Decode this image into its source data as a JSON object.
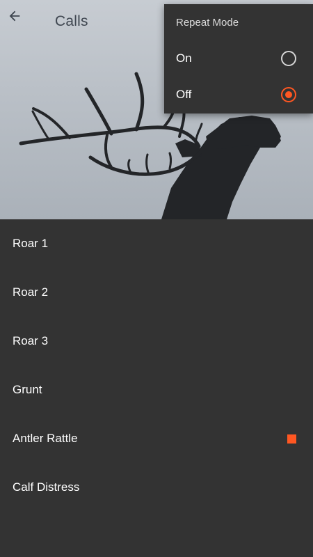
{
  "header": {
    "title": "Calls",
    "back_icon": "arrow-back-icon"
  },
  "hero": {
    "image": "elk-silhouette-photo"
  },
  "calls": [
    {
      "label": "Roar 1",
      "playing": false
    },
    {
      "label": "Roar 2",
      "playing": false
    },
    {
      "label": "Roar 3",
      "playing": false
    },
    {
      "label": "Grunt",
      "playing": false
    },
    {
      "label": "Antler Rattle",
      "playing": true
    },
    {
      "label": "Calf Distress",
      "playing": false
    }
  ],
  "repeat_menu": {
    "title": "Repeat Mode",
    "options": [
      {
        "label": "On",
        "selected": false
      },
      {
        "label": "Off",
        "selected": true
      }
    ]
  },
  "colors": {
    "accent": "#ff5722",
    "background": "#333333",
    "title_text": "#3f4650"
  }
}
